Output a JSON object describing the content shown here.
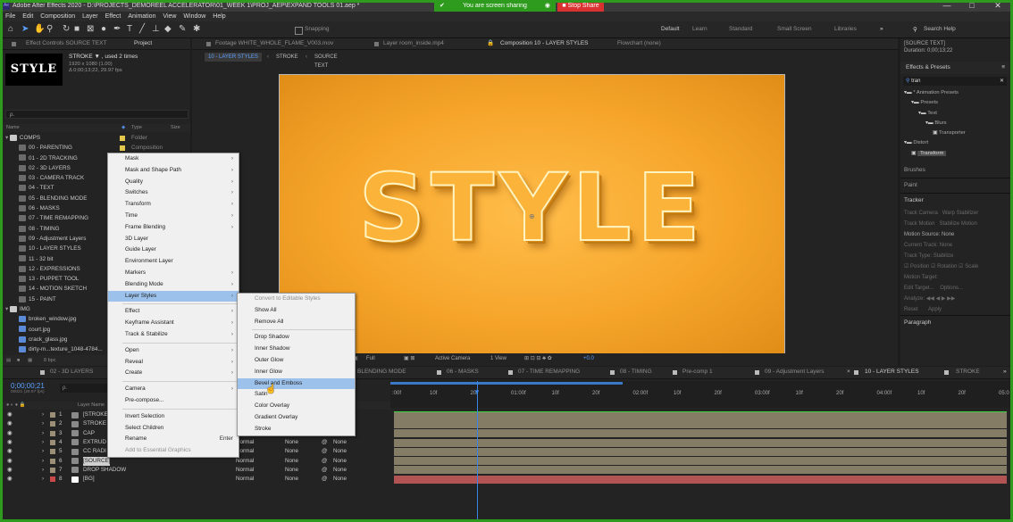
{
  "window": {
    "title": "Adobe After Effects 2020 - D:\\PROJECTS_DEMOREEL ACCELERATOR\\01_WEEK 1\\PROJ_AEP\\EXPAND TOOLS 01.aep *",
    "sharing_text": "You are screen sharing",
    "stop_share_label": "Stop Share",
    "controls": [
      "—",
      "□",
      "✕"
    ]
  },
  "menubar": [
    "File",
    "Edit",
    "Composition",
    "Layer",
    "Effect",
    "Animation",
    "View",
    "Window",
    "Help"
  ],
  "toolbar": {
    "snapping_label": "Snapping",
    "workspaces": [
      "Default",
      "Learn",
      "Standard",
      "Small Screen",
      "Libraries"
    ],
    "search_help": "Search Help"
  },
  "project_panel": {
    "tab_effect_controls": "Effect Controls SOURCE TEXT",
    "tab_project": "Project",
    "item_name": "STROKE ▼ , used 2 times",
    "item_info1": "1920 x 1080 (1.00)",
    "item_info2": "Δ 0;00;13;22, 29.97 fps",
    "thumb_text": "STYLE",
    "search_placeholder": "ρ.",
    "col_name": "Name",
    "col_type": "Type",
    "col_size": "Size",
    "items": [
      {
        "name": "COMPS",
        "type": "Folder",
        "kind": "folder",
        "color": "#e3c84d"
      },
      {
        "name": "00 - PARENTING",
        "type": "Composition",
        "kind": "comp",
        "color": "#e3c84d"
      },
      {
        "name": "01 - 2D TRACKING",
        "type": "",
        "kind": "comp",
        "color": "#e3c84d"
      },
      {
        "name": "02 - 3D LAYERS",
        "type": "",
        "kind": "comp",
        "color": "#e3c84d"
      },
      {
        "name": "03 - CAMERA TRACK",
        "type": "",
        "kind": "comp",
        "color": "#e3c84d"
      },
      {
        "name": "04 - TEXT",
        "type": "",
        "kind": "comp",
        "color": "#e3c84d"
      },
      {
        "name": "05 - BLENDING MODE",
        "type": "",
        "kind": "comp",
        "color": "#e3c84d"
      },
      {
        "name": "06 - MASKS",
        "type": "",
        "kind": "comp",
        "color": "#e3c84d"
      },
      {
        "name": "07 - TIME REMAPPING",
        "type": "",
        "kind": "comp",
        "color": "#e3c84d"
      },
      {
        "name": "08 - TIMING",
        "type": "",
        "kind": "comp",
        "color": "#e3c84d"
      },
      {
        "name": "09 - Adjustment Layers",
        "type": "",
        "kind": "comp",
        "color": "#e3c84d"
      },
      {
        "name": "10 - LAYER STYLES",
        "type": "",
        "kind": "comp",
        "color": "#e3c84d"
      },
      {
        "name": "11 - 32 bit",
        "type": "",
        "kind": "comp",
        "color": "#e3c84d"
      },
      {
        "name": "12 - EXPRESSIONS",
        "type": "",
        "kind": "comp",
        "color": "#e3c84d"
      },
      {
        "name": "13 - PUPPET TOOL",
        "type": "",
        "kind": "comp",
        "color": "#e3c84d"
      },
      {
        "name": "14 - MOTION SKETCH",
        "type": "",
        "kind": "comp",
        "color": "#e3c84d"
      },
      {
        "name": "15 - PAINT",
        "type": "",
        "kind": "comp",
        "color": "#e3c84d"
      },
      {
        "name": "IMG",
        "type": "",
        "kind": "folder",
        "color": "#e3c84d"
      },
      {
        "name": "broken_window.jpg",
        "type": "",
        "kind": "img",
        "color": "#8d8d8d"
      },
      {
        "name": "court.jpg",
        "type": "",
        "kind": "img",
        "color": "#8d8d8d"
      },
      {
        "name": "crack_glass.jpg",
        "type": "",
        "kind": "img",
        "color": "#8d8d8d"
      },
      {
        "name": "dirty-m...texture_1048-4784...",
        "type": "",
        "kind": "img",
        "color": "#8d8d8d"
      }
    ],
    "footer_bpc": "8 bpc"
  },
  "context_menu": {
    "items": [
      {
        "label": "Mask",
        "sub": true
      },
      {
        "label": "Mask and Shape Path",
        "sub": true
      },
      {
        "label": "Quality",
        "sub": true
      },
      {
        "label": "Switches",
        "sub": true
      },
      {
        "label": "Transform",
        "sub": true
      },
      {
        "label": "Time",
        "sub": true
      },
      {
        "label": "Frame Blending",
        "sub": true
      },
      {
        "label": "3D Layer",
        "sub": false
      },
      {
        "label": "Guide Layer",
        "sub": false
      },
      {
        "label": "Environment Layer",
        "sub": false
      },
      {
        "label": "Markers",
        "sub": true
      },
      {
        "label": "Blending Mode",
        "sub": true
      },
      {
        "label": "Layer Styles",
        "sub": true,
        "highlight": true
      },
      {
        "sep": true
      },
      {
        "label": "Effect",
        "sub": true
      },
      {
        "label": "Keyframe Assistant",
        "sub": true
      },
      {
        "label": "Track & Stabilize",
        "sub": true
      },
      {
        "sep": true
      },
      {
        "label": "Open",
        "sub": true
      },
      {
        "label": "Reveal",
        "sub": true
      },
      {
        "label": "Create",
        "sub": true
      },
      {
        "sep": true
      },
      {
        "label": "Camera",
        "sub": true
      },
      {
        "label": "Pre-compose...",
        "sub": false
      },
      {
        "sep": true
      },
      {
        "label": "Invert Selection",
        "sub": false
      },
      {
        "label": "Select Children",
        "sub": false
      },
      {
        "label": "Rename",
        "sub": false,
        "shortcut": "Enter"
      },
      {
        "label": "Add to Essential Graphics",
        "sub": false,
        "disabled": true
      }
    ]
  },
  "submenu": {
    "items": [
      {
        "label": "Convert to Editable Styles",
        "disabled": true
      },
      {
        "label": "Show All"
      },
      {
        "label": "Remove All"
      },
      {
        "sep": true
      },
      {
        "label": "Drop Shadow"
      },
      {
        "label": "Inner Shadow"
      },
      {
        "label": "Outer Glow"
      },
      {
        "label": "Inner Glow"
      },
      {
        "label": "Bevel and Emboss",
        "highlight": true
      },
      {
        "label": "Satin"
      },
      {
        "label": "Color Overlay"
      },
      {
        "label": "Gradient Overlay"
      },
      {
        "label": "Stroke"
      }
    ]
  },
  "viewer": {
    "tabs": [
      "Footage WHITE_WHOLE_FLAME_V003.mov",
      "Layer room_inside.mp4",
      "Composition 10 - LAYER STYLES",
      "Flowchart (none)"
    ],
    "breadcrumbs": [
      "10 - LAYER STYLES",
      "STROKE",
      "SOURCE TEXT"
    ],
    "comp_text": "STYLE",
    "bg_color": "#f3a42a",
    "footer": {
      "resolution": "Full",
      "camera": "Active Camera",
      "view": "1 View",
      "exposure": "+0.0"
    }
  },
  "right_panel": {
    "info_title": "[SOURCE TEXT]",
    "info_duration": "Duration: 0;00;13;22",
    "effects_title": "Effects & Presets",
    "search_value": "tran",
    "tree": [
      {
        "label": "* Animation Presets",
        "level": 0
      },
      {
        "label": "Presets",
        "level": 1
      },
      {
        "label": "Text",
        "level": 2
      },
      {
        "label": "Blurs",
        "level": 3
      },
      {
        "label": "Transporter",
        "level": 4
      },
      {
        "label": "Distort",
        "level": 0
      },
      {
        "label": "Transform",
        "level": 1,
        "highlight": true
      }
    ],
    "brushes": "Brushes",
    "paint": "Paint",
    "tracker": "Tracker",
    "tracker_buttons": [
      "Track Camera",
      "Warp Stabilizer",
      "Track Motion",
      "Stabilize Motion"
    ],
    "motion_source_label": "Motion Source:",
    "motion_source_value": "None",
    "current_track_label": "Current Track:",
    "current_track_value": "None",
    "track_type_label": "Track Type:",
    "track_type_value": "Stabilize",
    "checks": [
      "Position",
      "Rotation",
      "Scale"
    ],
    "motion_target": "Motion Target:",
    "edit_target": "Edit Target...",
    "options": "Options...",
    "analyze": "Analyze:",
    "reset": "Reset",
    "apply": "Apply",
    "paragraph": "Paragraph"
  },
  "timeline": {
    "tabs": [
      "02 - 3D LAYERS",
      "BLENDING MODE",
      "06 - MASKS",
      "07 - TIME REMAPPING",
      "08 - TIMING",
      "Pre-comp 1",
      "09 - Adjustment Layers",
      "10 - LAYER STYLES",
      "STROKE"
    ],
    "timecode": "0;00;00;21",
    "timecode_sub": "00021 (29.97 fps)",
    "layer_header": "Layer Name",
    "layers": [
      {
        "num": "1",
        "name": "[STROKE]",
        "color": "#c8c8c8"
      },
      {
        "num": "2",
        "name": "STROKE",
        "color": "#c8c8c8"
      },
      {
        "num": "3",
        "name": "CAP",
        "color": "#c8c8c8"
      },
      {
        "num": "4",
        "name": "EXTRUD",
        "color": "#c8c8c8"
      },
      {
        "num": "5",
        "name": "CC RADI",
        "color": "#c8c8c8"
      },
      {
        "num": "6",
        "name": "[SOURCE]",
        "color": "#c8c8c8"
      },
      {
        "num": "7",
        "name": "DROP SHADOW",
        "color": "#c8c8c8"
      },
      {
        "num": "8",
        "name": "[BG]",
        "color": "#c8c8c8"
      }
    ],
    "mode_rows": [
      {
        "mode": "",
        "trk": "",
        "parent": ""
      },
      {
        "mode": "",
        "trk": "",
        "parent": ""
      },
      {
        "mode": "",
        "trk": "",
        "parent": ""
      },
      {
        "mode": "Normal",
        "trk": "None",
        "parent": "None"
      },
      {
        "mode": "Normal",
        "trk": "None",
        "parent": "None"
      },
      {
        "mode": "Normal",
        "trk": "None",
        "parent": "None"
      },
      {
        "mode": "Normal",
        "trk": "None",
        "parent": "None"
      },
      {
        "mode": "Normal",
        "trk": "None",
        "parent": "None"
      }
    ],
    "ruler": [
      "10f",
      "20f",
      "01:00f",
      "10f",
      "20f",
      "02:00f",
      "10f",
      "20f",
      "03:00f",
      "10f",
      "20f",
      "04:00f",
      "10f",
      "20f",
      "05:0"
    ],
    "ruler_start": ":00f",
    "bar_color": "#857c66",
    "bar_last_color": "#b25454"
  }
}
